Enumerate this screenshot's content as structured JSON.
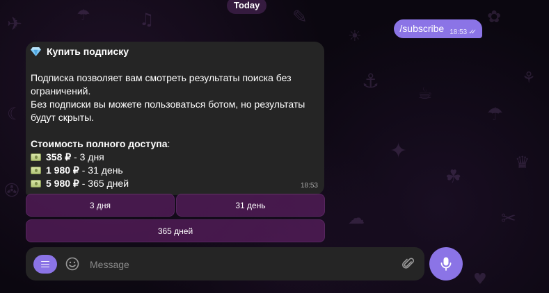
{
  "date_pill": "Today",
  "outgoing": {
    "text": "/subscribe",
    "time": "18:53"
  },
  "bot_message": {
    "title": "Купить подписку",
    "paragraph1": "Подписка позволяет вам смотреть результаты поиска без ограничений.",
    "paragraph2": "Без подписки вы можете пользоваться ботом, но результаты будут скрыты.",
    "price_header": "Стоимость полного доступа",
    "prices": [
      {
        "amount": "358 ₽",
        "period": " - 3 дня"
      },
      {
        "amount": "1 980 ₽",
        "period": " - 31 день"
      },
      {
        "amount": "5 980 ₽",
        "period": " - 365 дней"
      }
    ],
    "time": "18:53"
  },
  "keyboard": {
    "buttons": [
      "3 дня",
      "31 день",
      "365 дней"
    ]
  },
  "composer": {
    "placeholder": "Message"
  },
  "colors": {
    "accent": "#8b74e6",
    "bubble": "#252525",
    "keyboard_button": "#5a1e5f"
  },
  "icons": {
    "title": "gem-icon",
    "price": "cash-icon",
    "menu": "menu-icon",
    "emoji": "emoji-icon",
    "attach": "paperclip-icon",
    "send": "microphone-icon",
    "read": "double-check-icon"
  }
}
